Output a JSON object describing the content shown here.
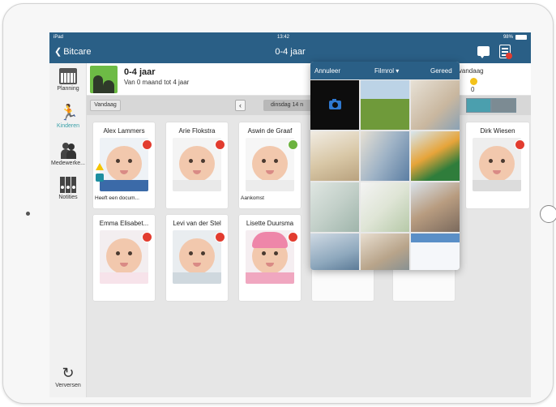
{
  "status_bar": {
    "left": "iPad",
    "time": "13:42",
    "battery": "98%"
  },
  "nav": {
    "back_label": "Bitcare",
    "title": "0-4 jaar"
  },
  "sidebar": {
    "items": [
      {
        "label": "Planning",
        "icon": "calendar-icon"
      },
      {
        "label": "Kinderen",
        "icon": "running-child-icon"
      },
      {
        "label": "Medewerke...",
        "icon": "people-icon"
      },
      {
        "label": "Notities",
        "icon": "binders-icon"
      },
      {
        "label": "Verversen",
        "icon": "refresh-icon"
      }
    ]
  },
  "group": {
    "title": "0-4 jaar",
    "subtitle": "Van 0 maand tot 4 jaar",
    "right_label": "cht vandaag",
    "right_count": "0"
  },
  "toolbar": {
    "today_label": "Vandaag",
    "prev_symbol": "‹",
    "date_text": "dinsdag 14 n"
  },
  "children": [
    {
      "name": "Alex Lammers",
      "status": "red",
      "note": "Heeft een docum..."
    },
    {
      "name": "Arie Flokstra",
      "status": "red",
      "note": ""
    },
    {
      "name": "Aswin de Graaf",
      "status": "green",
      "note": "Aankomst"
    },
    {
      "name": "Dirk Wiesen",
      "status": "red",
      "note": ""
    },
    {
      "name": "Emma Elisabet...",
      "status": "red",
      "note": ""
    },
    {
      "name": "Levi van der Stel",
      "status": "red",
      "note": ""
    },
    {
      "name": "Lisette Duursma",
      "status": "red",
      "note": ""
    }
  ],
  "picker": {
    "cancel_label": "Annuleer",
    "roll_label": "Filmrol ▾",
    "done_label": "Gereed"
  },
  "colors": {
    "header_blue": "#2a5f86",
    "accent_teal": "#3aa0a8",
    "status_red": "#e23c2f",
    "status_green": "#6cb33f"
  }
}
